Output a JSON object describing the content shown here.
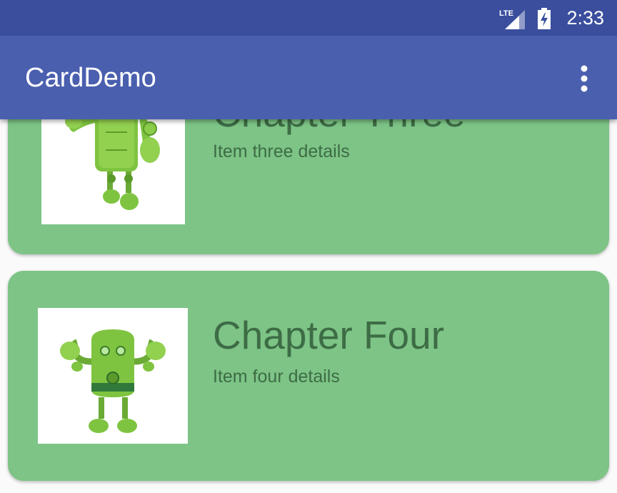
{
  "status_bar": {
    "network": "LTE",
    "time": "2:33",
    "icons": [
      "lte-signal-icon",
      "battery-charging-icon"
    ]
  },
  "app_bar": {
    "title": "CardDemo",
    "overflow_icon": "more-vert-icon"
  },
  "colors": {
    "status_bar": "#3a4e9d",
    "app_bar": "#4a5fae",
    "card": "#7dc486",
    "card_text": "#3d6c45"
  },
  "cards": [
    {
      "title": "Chapter Three",
      "detail": "Item three details",
      "image": "android-robot-waving"
    },
    {
      "title": "Chapter Four",
      "detail": "Item four details",
      "image": "android-robot-flexing"
    }
  ]
}
